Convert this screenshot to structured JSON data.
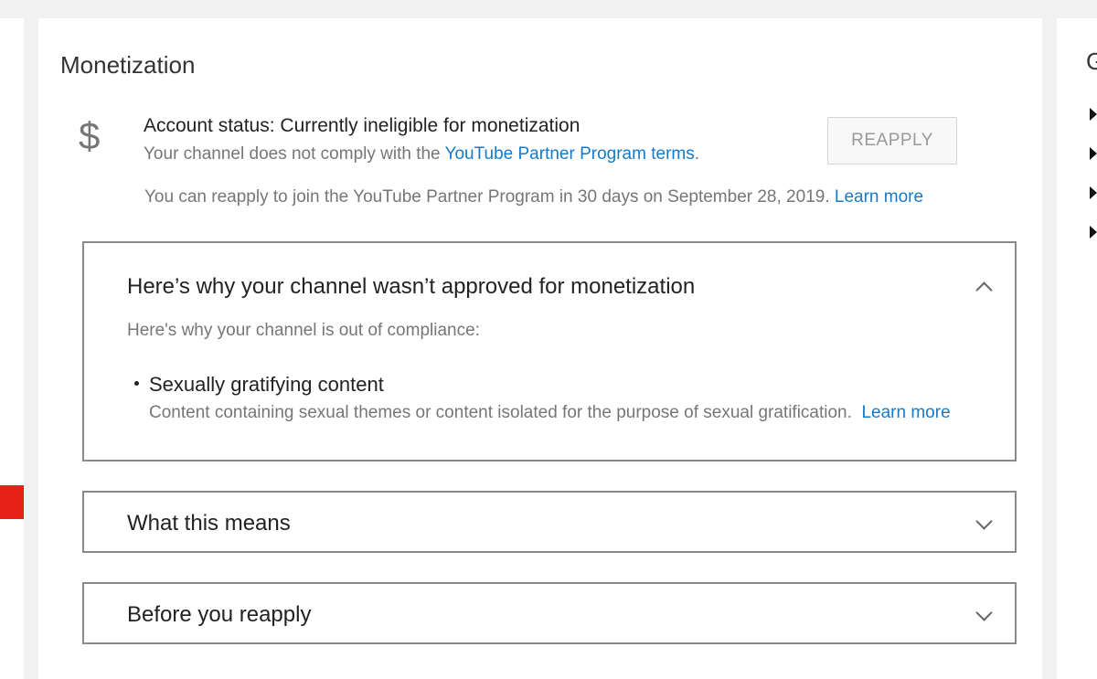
{
  "page": {
    "title": "Monetization"
  },
  "account_status": {
    "icon": "dollar-icon",
    "icon_glyph": "$",
    "title": "Account status: Currently ineligible for monetization",
    "subtitle_prefix": "Your channel does not comply with the ",
    "subtitle_link": "YouTube Partner Program terms",
    "subtitle_suffix": ".",
    "reapply_info": "You can reapply to join the YouTube Partner Program in 30 days on September 28, 2019.",
    "reapply_info_link": "Learn more",
    "reapply_button": "REAPPLY"
  },
  "panels": [
    {
      "title": "Here’s why your channel wasn’t approved for monetization",
      "expanded": true,
      "subtitle": "Here's why your channel is out of compliance:",
      "reasons": [
        {
          "title": "Sexually gratifying content",
          "description": "Content containing sexual themes or content isolated for the purpose of sexual gratification.",
          "link": "Learn more"
        }
      ]
    },
    {
      "title": "What this means",
      "expanded": false
    },
    {
      "title": "Before you reapply",
      "expanded": false
    }
  ],
  "right_sidebar": {
    "heading_initial": "G"
  },
  "colors": {
    "link": "#167ac6",
    "marker": "#e62117",
    "background": "#f1f1f1"
  }
}
